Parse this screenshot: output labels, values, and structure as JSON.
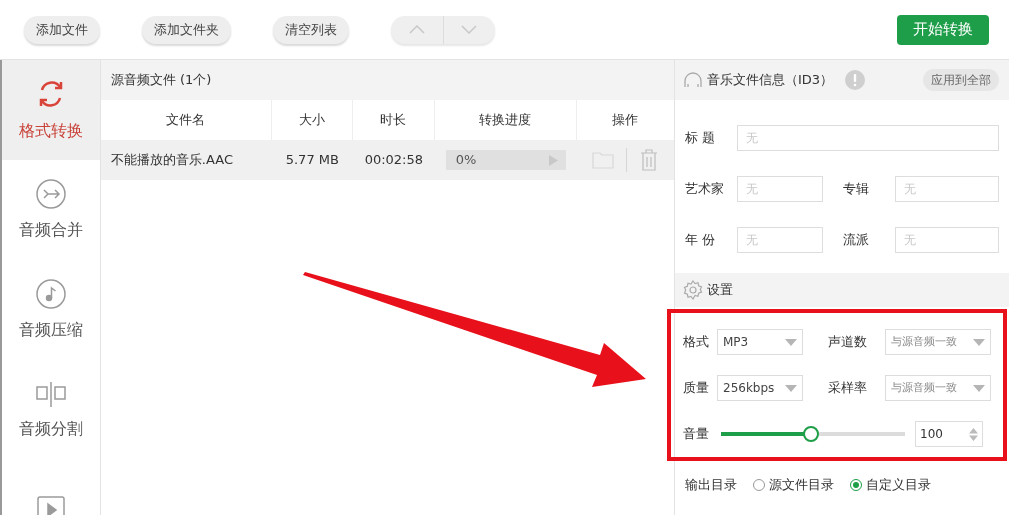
{
  "toolbar": {
    "buttons": [
      "添加文件",
      "添加文件夹",
      "清空列表"
    ],
    "start_button": "开始转换"
  },
  "sidebar": {
    "items": [
      {
        "kind": "convert",
        "label": "格式转换",
        "selected": true
      },
      {
        "kind": "merge",
        "label": "音频合并",
        "selected": false
      },
      {
        "kind": "compress",
        "label": "音频压缩",
        "selected": false
      },
      {
        "kind": "split",
        "label": "音频分割",
        "selected": false
      },
      {
        "kind": "video",
        "selected": false
      }
    ]
  },
  "file_list": {
    "title": "源音频文件 (1个)",
    "columns": [
      "文件名",
      "大小",
      "时长",
      "转换进度",
      "操作"
    ],
    "rows": [
      {
        "name": "不能播放的音乐.AAC",
        "size": "5.77 MB",
        "duration": "00:02:58",
        "progress": "0%",
        "level": 0
      }
    ]
  },
  "id3": {
    "title": "音乐文件信息（ID3）",
    "apply_button": "应用到全部",
    "field_rows": [
      [
        {
          "label": "标 题",
          "placeholder": "无"
        }
      ],
      [
        {
          "label": "艺术家",
          "placeholder": "无"
        },
        {
          "label": "专辑",
          "placeholder": "无"
        }
      ],
      [
        {
          "label": "年 份",
          "placeholder": "无"
        },
        {
          "label": "流派",
          "placeholder": "无"
        }
      ]
    ]
  },
  "settings": {
    "title": "设置",
    "selects": [
      {
        "label": "格式",
        "value": "MP3"
      },
      {
        "label": "声道数",
        "value": "与源音频一致"
      },
      {
        "label": "质量",
        "value": "256kbps"
      },
      {
        "label": "采样率",
        "value": "与源音频一致"
      }
    ],
    "volume": {
      "label": "音量",
      "level": 0.49,
      "value": "100"
    }
  },
  "output": {
    "label": "输出目录",
    "options": [
      {
        "label": "源文件目录",
        "selected": false
      },
      {
        "label": "自定义目录",
        "selected": true
      }
    ]
  }
}
